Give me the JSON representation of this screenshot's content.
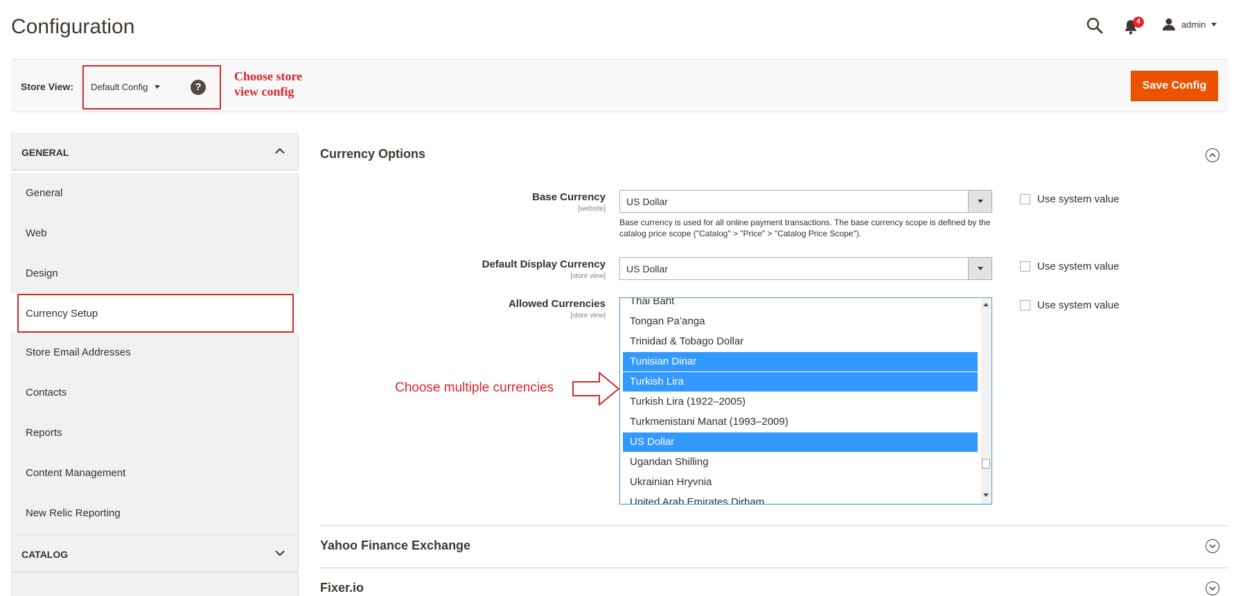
{
  "header": {
    "title": "Configuration",
    "notification_count": "4",
    "user_name": "admin"
  },
  "store_bar": {
    "label": "Store View:",
    "selected": "Default Config",
    "help": "?",
    "annotation_line1": "Choose store",
    "annotation_line2": "view config",
    "save_label": "Save Config"
  },
  "sidebar": {
    "general_title": "GENERAL",
    "items": [
      {
        "label": "General"
      },
      {
        "label": "Web"
      },
      {
        "label": "Design"
      },
      {
        "label": "Currency Setup"
      },
      {
        "label": "Store Email Addresses"
      },
      {
        "label": "Contacts"
      },
      {
        "label": "Reports"
      },
      {
        "label": "Content Management"
      },
      {
        "label": "New Relic Reporting"
      }
    ],
    "catalog_title": "CATALOG"
  },
  "main": {
    "currency_options_title": "Currency Options",
    "base_currency": {
      "label": "Base Currency",
      "scope": "[website]",
      "value": "US Dollar",
      "note": "Base currency is used for all online payment transactions. The base currency scope is defined by the catalog price scope (\"Catalog\" > \"Price\" > \"Catalog Price Scope\").",
      "system_value": "Use system value"
    },
    "display_currency": {
      "label": "Default Display Currency",
      "scope": "[store view]",
      "value": "US Dollar",
      "system_value": "Use system value"
    },
    "allowed_currencies": {
      "label": "Allowed Currencies",
      "scope": "[store view]",
      "system_value": "Use system value",
      "options": [
        {
          "label": "Thai Baht",
          "selected": false
        },
        {
          "label": "Tongan Paʻanga",
          "selected": false
        },
        {
          "label": "Trinidad & Tobago Dollar",
          "selected": false
        },
        {
          "label": "Tunisian Dinar",
          "selected": true
        },
        {
          "label": "Turkish Lira",
          "selected": true
        },
        {
          "label": "Turkish Lira (1922–2005)",
          "selected": false
        },
        {
          "label": "Turkmenistani Manat (1993–2009)",
          "selected": false
        },
        {
          "label": "US Dollar",
          "selected": true
        },
        {
          "label": "Ugandan Shilling",
          "selected": false
        },
        {
          "label": "Ukrainian Hryvnia",
          "selected": false
        },
        {
          "label": "United Arab Emirates Dirham",
          "selected": false
        }
      ]
    },
    "annotation_multi": "Choose multiple currencies",
    "yahoo_title": "Yahoo Finance Exchange",
    "fixer_title": "Fixer.io"
  }
}
